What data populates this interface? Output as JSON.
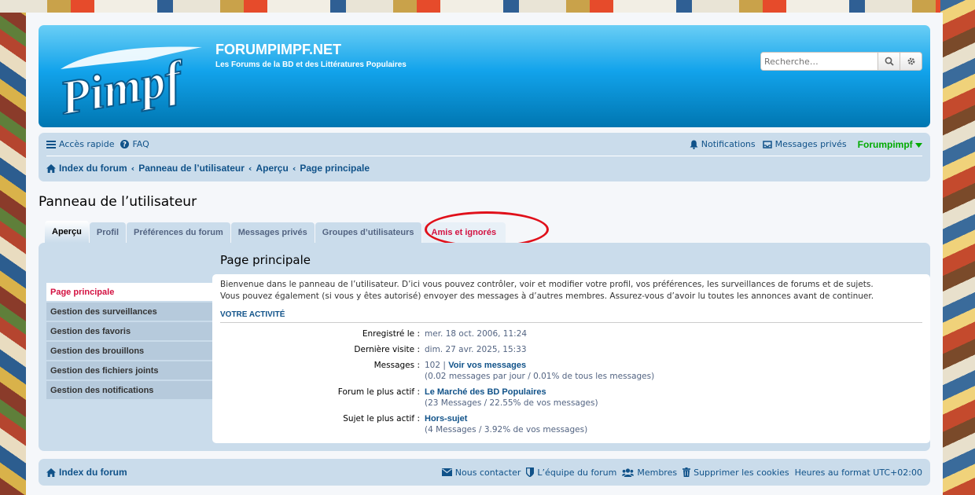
{
  "site": {
    "title": "FORUMPIMPF.NET",
    "description": "Les Forums de la BD et des Littératures Populaires",
    "logo_text": "Pimpf"
  },
  "search": {
    "placeholder": "Recherche…"
  },
  "nav": {
    "quick_access": "Accès rapide",
    "faq": "FAQ",
    "notifications": "Notifications",
    "private_messages": "Messages privés",
    "username": "Forumpimpf",
    "breadcrumbs": [
      "Index du forum",
      "Panneau de l’utilisateur",
      "Aperçu",
      "Page principale"
    ]
  },
  "page": {
    "title": "Panneau de l’utilisateur"
  },
  "tabs": [
    {
      "label": "Aperçu"
    },
    {
      "label": "Profil"
    },
    {
      "label": "Préférences du forum"
    },
    {
      "label": "Messages privés"
    },
    {
      "label": "Groupes d’utilisateurs"
    },
    {
      "label": "Amis et ignorés"
    }
  ],
  "sidebar": [
    {
      "label": "Page principale"
    },
    {
      "label": "Gestion des surveillances"
    },
    {
      "label": "Gestion des favoris"
    },
    {
      "label": "Gestion des brouillons"
    },
    {
      "label": "Gestion des fichiers joints"
    },
    {
      "label": "Gestion des notifications"
    }
  ],
  "main": {
    "title": "Page principale",
    "intro_1": "Bienvenue dans le panneau de l’utilisateur. D’ici vous pouvez contrôler, voir et modifier votre profil, vos préférences, les surveillances de forums et de sujets.",
    "intro_2": "Vous pouvez également (si vous y êtes autorisé) envoyer des messages à d’autres membres. Assurez-vous d’avoir lu toutes les annonces avant de continuer.",
    "activity_title": "VOTRE ACTIVITÉ",
    "stats": {
      "registered_label": "Enregistré le :",
      "registered_value": "mer. 18 oct. 2006, 11:24",
      "last_visit_label": "Dernière visite :",
      "last_visit_value": "dim. 27 avr. 2025, 15:33",
      "messages_label": "Messages :",
      "messages_count": "102 |",
      "messages_link": "Voir vos messages",
      "messages_detail": "(0.02 messages par jour / 0.01% de tous les messages)",
      "active_forum_label": "Forum le plus actif :",
      "active_forum_link": "Le Marché des BD Populaires",
      "active_forum_detail": "(23 Messages / 22.55% de vos messages)",
      "active_topic_label": "Sujet le plus actif :",
      "active_topic_link": "Hors-sujet",
      "active_topic_detail": "(4 Messages / 3.92% de vos messages)"
    }
  },
  "footer": {
    "index": "Index du forum",
    "contact": "Nous contacter",
    "team": "L’équipe du forum",
    "members": "Membres",
    "delete_cookies": "Supprimer les cookies",
    "timezone": "Heures au format UTC+02:00"
  },
  "colors": {
    "link": "#105289",
    "highlight_tab": "#d31141",
    "annotation_circle": "#e0101a",
    "username": "#00aa00"
  }
}
